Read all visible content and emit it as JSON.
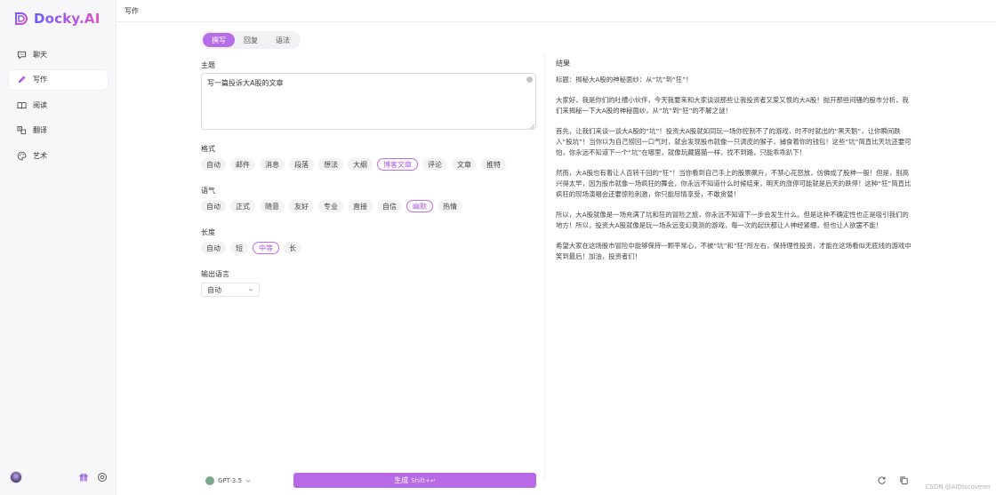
{
  "app": {
    "name": "Docky.AI",
    "page_title": "写作"
  },
  "sidebar": {
    "items": [
      {
        "label": "聊天",
        "icon": "chat-icon",
        "active": false
      },
      {
        "label": "写作",
        "icon": "pen-icon",
        "active": true
      },
      {
        "label": "阅读",
        "icon": "book-icon",
        "active": false
      },
      {
        "label": "翻译",
        "icon": "translate-icon",
        "active": false
      },
      {
        "label": "艺术",
        "icon": "palette-icon",
        "active": false
      }
    ]
  },
  "tabs": [
    {
      "label": "撰写",
      "active": true
    },
    {
      "label": "回复",
      "active": false
    },
    {
      "label": "语法",
      "active": false
    }
  ],
  "topic": {
    "label": "主题",
    "value": "写一篇投诉大A股的文章"
  },
  "format": {
    "label": "格式",
    "options": [
      "自动",
      "邮件",
      "消息",
      "段落",
      "想法",
      "大纲",
      "博客文章",
      "评论",
      "文章",
      "推特"
    ],
    "selected": "博客文章"
  },
  "tone": {
    "label": "语气",
    "options": [
      "自动",
      "正式",
      "随意",
      "友好",
      "专业",
      "直接",
      "自信",
      "幽默",
      "热情"
    ],
    "selected": "幽默"
  },
  "length": {
    "label": "长度",
    "options": [
      "自动",
      "短",
      "中等",
      "长"
    ],
    "selected": "中等"
  },
  "output_language": {
    "label": "输出语言",
    "value": "自动"
  },
  "model": {
    "label": "GPT-3.5"
  },
  "generate": {
    "label": "生成",
    "hint": "Shift+↵"
  },
  "result": {
    "label": "结果",
    "paragraphs": [
      "标题：揭秘大A股的神秘面纱：从“坑”到“狂”！",
      "大家好，我是你们的吐槽小伙伴，今天我要来和大家谈谈那些让我投资者又爱又恨的大A股！抛开那些闷骚的股市分析，我们来揭秘一下大A股的神秘面纱，从“坑”到“狂”的不解之谜！",
      "首先，让我们来谈一谈大A股的“坑”！投资大A股就如同玩一场你控制不了的游戏，时不时就出的“黑天鹅”，让你瞬间跌入“股坑”！当你以为自己捞回一口气时，就会发现股市就像一只调皮的猴子，捕食着你的钱包！这些“坑”简直比天坑还要可怕，你永远不知道下一个“坑”在哪里，就像玩藏猫猫一样，找不到路，只能乖乖趴下！",
      "然而，大A股也有着让人百转千回的“狂”！当你看到自己手上的股票飙升，不禁心花怒放，仿佛成了股神一般！但是，别高兴得太早，因为股市就像一场疯狂的舞会，你永远不知道什么时候结束，明天的涨停可能就是后天的跌停！这种“狂”简直比疯狂的现场演唱会还要惊险刺激，你只能尽情享受，不敢贪婪！",
      "所以，大A股就像是一场充满了坑和狂的冒险之旅，你永远不知道下一步会发生什么。但是这种不确定性也正是吸引我们的地方！所以，投资大A股就像是玩一场永远变幻莫测的游戏，每一次的起伏都让人神经紧绷，但也让人欲罢不能！",
      "希望大家在这场股市冒险中能够保持一颗平常心，不被“坑”和“狂”所左右，保持理性投资，才能在这场看似无底线的游戏中笑到最后！加油，投资者们！"
    ]
  },
  "watermark": "CSDN @AIDiscoverer",
  "colors": {
    "accent": "#b86ae6",
    "brand_start": "#6b5bff",
    "brand_end": "#e254c8"
  }
}
